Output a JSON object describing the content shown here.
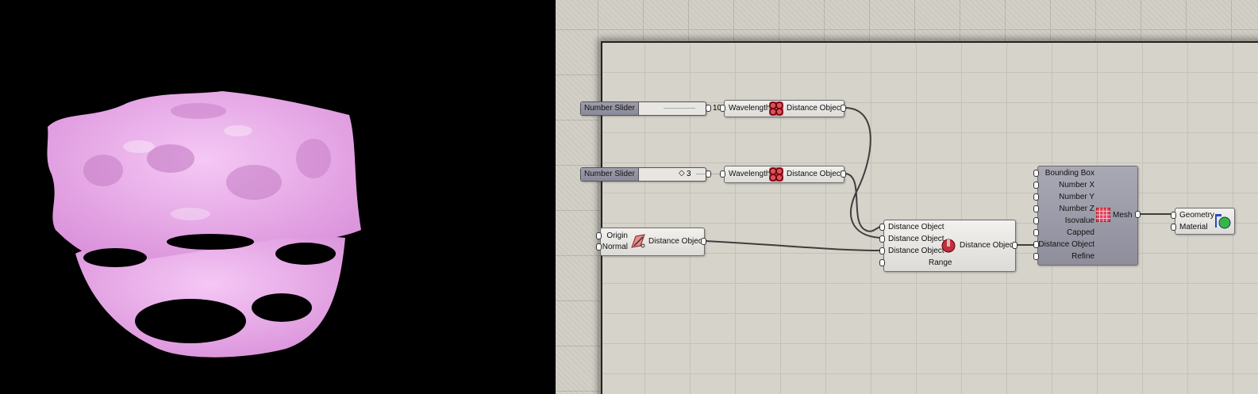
{
  "viewport": {
    "mesh_color": "#e6a9e6"
  },
  "canvas": {
    "sliders": [
      {
        "name": "Number Slider",
        "value": "10"
      },
      {
        "name": "Number Slider",
        "value": "3"
      }
    ],
    "nodes": {
      "distance_object_1": {
        "input": "Wavelength",
        "output": "Distance Object"
      },
      "distance_object_2": {
        "input": "Wavelength",
        "output": "Distance Object"
      },
      "plane_distance": {
        "inputs": [
          "Origin",
          "Normal"
        ],
        "output": "Distance Object"
      },
      "combine": {
        "inputs": [
          "Distance Object",
          "Distance Object",
          "Distance Object",
          "Range"
        ],
        "output": "Distance Object"
      },
      "mesher": {
        "inputs": [
          "Bounding Box",
          "Number X",
          "Number Y",
          "Number Z",
          "Isovalue",
          "Capped",
          "Distance Object",
          "Refine"
        ],
        "output": "Mesh"
      },
      "preview": {
        "inputs": [
          "Geometry",
          "Material"
        ]
      }
    },
    "icons": [
      "gyroid-icon",
      "plane-icon",
      "sphere-icon",
      "mesh-grid-icon",
      "preview-icon"
    ]
  }
}
